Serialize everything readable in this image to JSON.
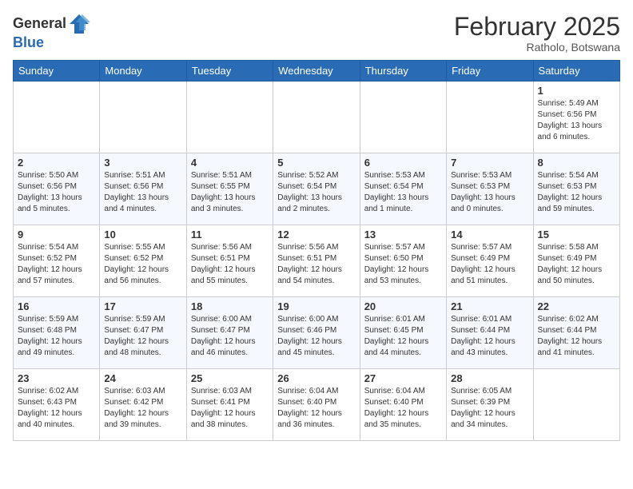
{
  "header": {
    "logo_general": "General",
    "logo_blue": "Blue",
    "month": "February 2025",
    "location": "Ratholo, Botswana"
  },
  "weekdays": [
    "Sunday",
    "Monday",
    "Tuesday",
    "Wednesday",
    "Thursday",
    "Friday",
    "Saturday"
  ],
  "weeks": [
    [
      {
        "day": "",
        "info": ""
      },
      {
        "day": "",
        "info": ""
      },
      {
        "day": "",
        "info": ""
      },
      {
        "day": "",
        "info": ""
      },
      {
        "day": "",
        "info": ""
      },
      {
        "day": "",
        "info": ""
      },
      {
        "day": "1",
        "info": "Sunrise: 5:49 AM\nSunset: 6:56 PM\nDaylight: 13 hours\nand 6 minutes."
      }
    ],
    [
      {
        "day": "2",
        "info": "Sunrise: 5:50 AM\nSunset: 6:56 PM\nDaylight: 13 hours\nand 5 minutes."
      },
      {
        "day": "3",
        "info": "Sunrise: 5:51 AM\nSunset: 6:56 PM\nDaylight: 13 hours\nand 4 minutes."
      },
      {
        "day": "4",
        "info": "Sunrise: 5:51 AM\nSunset: 6:55 PM\nDaylight: 13 hours\nand 3 minutes."
      },
      {
        "day": "5",
        "info": "Sunrise: 5:52 AM\nSunset: 6:54 PM\nDaylight: 13 hours\nand 2 minutes."
      },
      {
        "day": "6",
        "info": "Sunrise: 5:53 AM\nSunset: 6:54 PM\nDaylight: 13 hours\nand 1 minute."
      },
      {
        "day": "7",
        "info": "Sunrise: 5:53 AM\nSunset: 6:53 PM\nDaylight: 13 hours\nand 0 minutes."
      },
      {
        "day": "8",
        "info": "Sunrise: 5:54 AM\nSunset: 6:53 PM\nDaylight: 12 hours\nand 59 minutes."
      }
    ],
    [
      {
        "day": "9",
        "info": "Sunrise: 5:54 AM\nSunset: 6:52 PM\nDaylight: 12 hours\nand 57 minutes."
      },
      {
        "day": "10",
        "info": "Sunrise: 5:55 AM\nSunset: 6:52 PM\nDaylight: 12 hours\nand 56 minutes."
      },
      {
        "day": "11",
        "info": "Sunrise: 5:56 AM\nSunset: 6:51 PM\nDaylight: 12 hours\nand 55 minutes."
      },
      {
        "day": "12",
        "info": "Sunrise: 5:56 AM\nSunset: 6:51 PM\nDaylight: 12 hours\nand 54 minutes."
      },
      {
        "day": "13",
        "info": "Sunrise: 5:57 AM\nSunset: 6:50 PM\nDaylight: 12 hours\nand 53 minutes."
      },
      {
        "day": "14",
        "info": "Sunrise: 5:57 AM\nSunset: 6:49 PM\nDaylight: 12 hours\nand 51 minutes."
      },
      {
        "day": "15",
        "info": "Sunrise: 5:58 AM\nSunset: 6:49 PM\nDaylight: 12 hours\nand 50 minutes."
      }
    ],
    [
      {
        "day": "16",
        "info": "Sunrise: 5:59 AM\nSunset: 6:48 PM\nDaylight: 12 hours\nand 49 minutes."
      },
      {
        "day": "17",
        "info": "Sunrise: 5:59 AM\nSunset: 6:47 PM\nDaylight: 12 hours\nand 48 minutes."
      },
      {
        "day": "18",
        "info": "Sunrise: 6:00 AM\nSunset: 6:47 PM\nDaylight: 12 hours\nand 46 minutes."
      },
      {
        "day": "19",
        "info": "Sunrise: 6:00 AM\nSunset: 6:46 PM\nDaylight: 12 hours\nand 45 minutes."
      },
      {
        "day": "20",
        "info": "Sunrise: 6:01 AM\nSunset: 6:45 PM\nDaylight: 12 hours\nand 44 minutes."
      },
      {
        "day": "21",
        "info": "Sunrise: 6:01 AM\nSunset: 6:44 PM\nDaylight: 12 hours\nand 43 minutes."
      },
      {
        "day": "22",
        "info": "Sunrise: 6:02 AM\nSunset: 6:44 PM\nDaylight: 12 hours\nand 41 minutes."
      }
    ],
    [
      {
        "day": "23",
        "info": "Sunrise: 6:02 AM\nSunset: 6:43 PM\nDaylight: 12 hours\nand 40 minutes."
      },
      {
        "day": "24",
        "info": "Sunrise: 6:03 AM\nSunset: 6:42 PM\nDaylight: 12 hours\nand 39 minutes."
      },
      {
        "day": "25",
        "info": "Sunrise: 6:03 AM\nSunset: 6:41 PM\nDaylight: 12 hours\nand 38 minutes."
      },
      {
        "day": "26",
        "info": "Sunrise: 6:04 AM\nSunset: 6:40 PM\nDaylight: 12 hours\nand 36 minutes."
      },
      {
        "day": "27",
        "info": "Sunrise: 6:04 AM\nSunset: 6:40 PM\nDaylight: 12 hours\nand 35 minutes."
      },
      {
        "day": "28",
        "info": "Sunrise: 6:05 AM\nSunset: 6:39 PM\nDaylight: 12 hours\nand 34 minutes."
      },
      {
        "day": "",
        "info": ""
      }
    ]
  ]
}
